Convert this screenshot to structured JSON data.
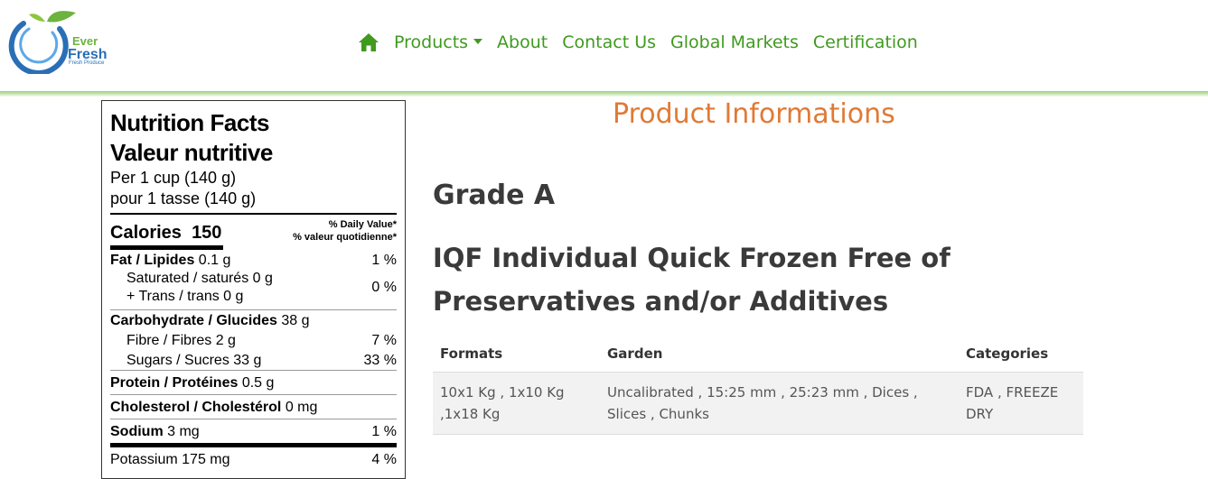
{
  "brand": {
    "name_line1": "Ever",
    "name_line2": "Fresh",
    "tagline": "Fresh Produce"
  },
  "nav": {
    "home_icon": "home-icon",
    "items": [
      "Products",
      "About",
      "Contact Us",
      "Global Markets",
      "Certification"
    ]
  },
  "colors": {
    "nav_green": "#3f9a1e",
    "heading_orange": "#e07a35",
    "text_dark": "#3a3a3a"
  },
  "nutrition": {
    "title_en": "Nutrition Facts",
    "title_fr": "Valeur nutritive",
    "serving_en": "Per 1 cup (140 g)",
    "serving_fr": "pour 1 tasse (140 g)",
    "calories_label": "Calories",
    "calories_value": "150",
    "dv_en": "% Daily Value*",
    "dv_fr": "% valeur quotidienne*",
    "fat_label": "Fat / Lipides",
    "fat_value": "0.1 g",
    "fat_pct": "1 %",
    "saturated": "Saturated / saturés 0 g",
    "trans": "+ Trans / trans 0 g",
    "sat_trans_pct": "0 %",
    "carb_label": "Carbohydrate / Glucides",
    "carb_value": "38 g",
    "fibre": "Fibre / Fibres 2 g",
    "fibre_pct": "7 %",
    "sugars": "Sugars / Sucres 33 g",
    "sugars_pct": "33 %",
    "protein_label": "Protein / Protéines",
    "protein_value": "0.5 g",
    "chol_label": "Cholesterol / Cholestérol",
    "chol_value": "0 mg",
    "sodium_label": "Sodium",
    "sodium_value": "3 mg",
    "sodium_pct": "1 %",
    "potassium": "Potassium 175 mg",
    "potassium_pct": "4 %"
  },
  "product": {
    "section_title": "Product Informations",
    "grade": "Grade A",
    "description": "IQF Individual Quick Frozen Free of Preservatives and/or Additives",
    "table": {
      "headers": [
        "Formats",
        "Garden",
        "Categories"
      ],
      "row": {
        "formats": "10x1 Kg , 1x10 Kg ,1x18 Kg",
        "garden": "Uncalibrated , 15:25 mm , 25:23 mm , Dices , Slices , Chunks",
        "categories": "FDA , FREEZE DRY"
      }
    }
  }
}
